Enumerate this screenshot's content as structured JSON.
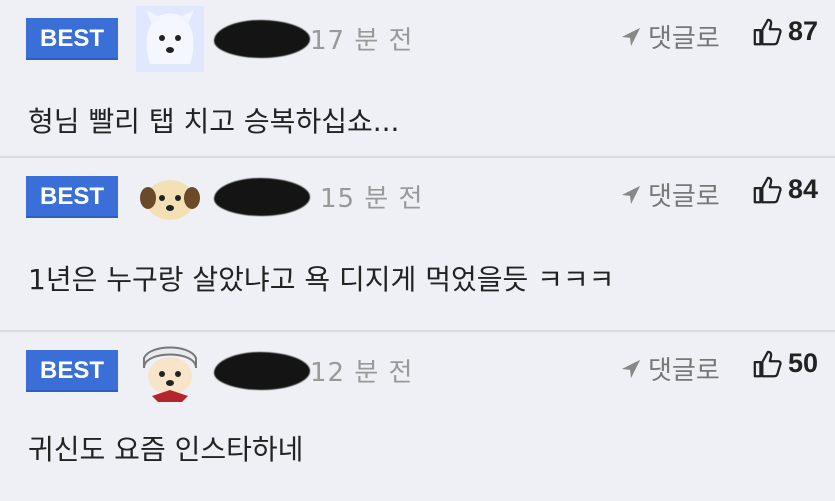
{
  "comments": [
    {
      "badge": "BEST",
      "time": "17 분 전",
      "reply_label": "댓글로",
      "likes": "87",
      "text": "형님 빨리 탭 치고 승복하십쇼..."
    },
    {
      "badge": "BEST",
      "time": "15 분 전",
      "reply_label": "댓글로",
      "likes": "84",
      "text": "1년은 누구랑 살았냐고 욕 디지게 먹었을듯 ㅋㅋㅋ"
    },
    {
      "badge": "BEST",
      "time": "12 분 전",
      "reply_label": "댓글로",
      "likes": "50",
      "text": "귀신도 요즘 인스타하네"
    }
  ],
  "colors": {
    "badge": "#3a6fd8",
    "background": "#eef0f6",
    "divider": "#d9dbe2"
  }
}
